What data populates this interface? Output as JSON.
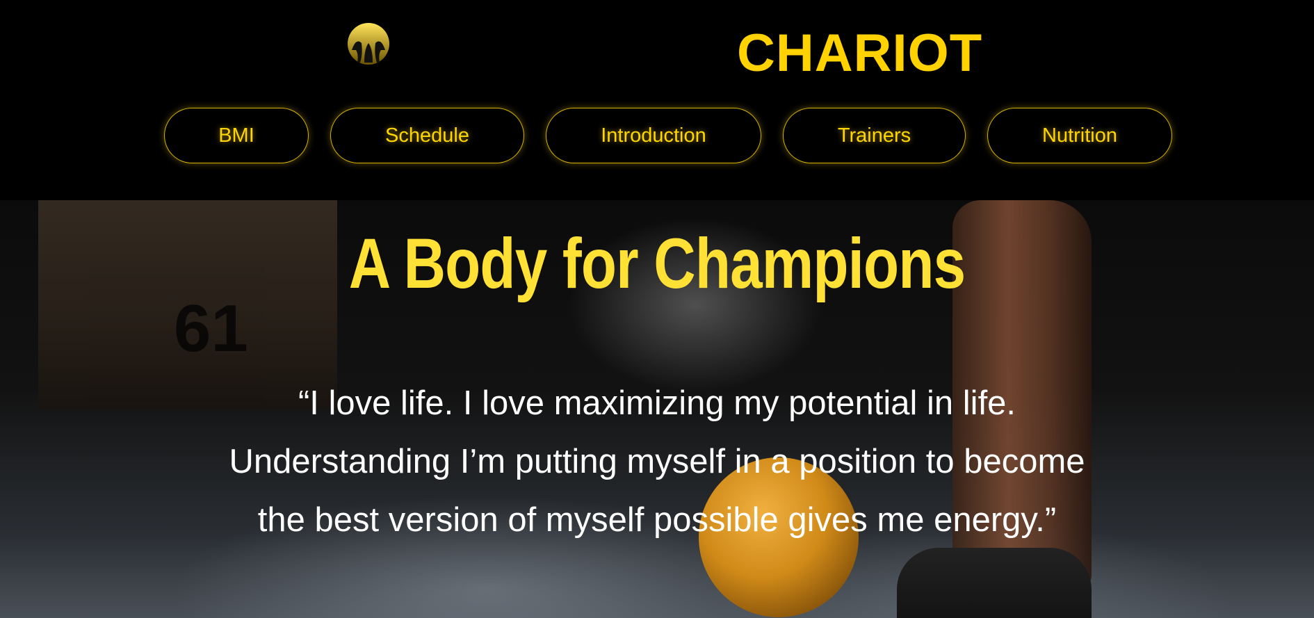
{
  "header": {
    "brand": "CHARIOT",
    "logo_icon": "chariot-crest-icon"
  },
  "nav": {
    "items": [
      {
        "label": "BMI"
      },
      {
        "label": "Schedule"
      },
      {
        "label": "Introduction"
      },
      {
        "label": "Trainers"
      },
      {
        "label": "Nutrition"
      }
    ]
  },
  "hero": {
    "title": "A Body for Champions",
    "quote": "“I love life. I love maximizing my potential in life. Understanding I’m putting myself in a position to become the best version of myself possible gives me energy.”",
    "box_number": "61"
  },
  "colors": {
    "accent": "#ffd200",
    "background": "#000000",
    "text": "#ffffff"
  }
}
